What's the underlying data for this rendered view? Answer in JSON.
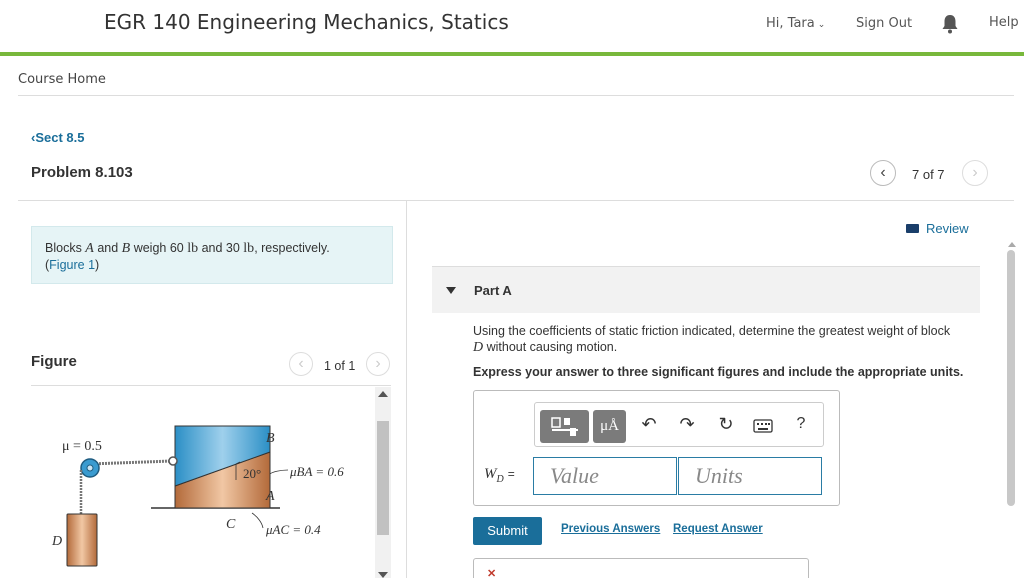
{
  "header": {
    "course_title": "EGR 140 Engineering Mechanics, Statics",
    "greeting": "Hi, Tara",
    "sign_out": "Sign Out",
    "help": "Help"
  },
  "breadcrumb": "Course Home",
  "back_link": "Sect 8.5",
  "problem_title": "Problem 8.103",
  "pager": {
    "label": "7 of 7"
  },
  "statement": {
    "t1": "Blocks ",
    "a": "A",
    "t2": " and ",
    "b": "B",
    "t3": " weigh 60 ",
    "u1": "lb",
    "t4": " and 30 ",
    "u2": "lb",
    "t5": ", respectively.",
    "fig_open": "(",
    "fig_link": "Figure 1",
    "fig_close": ")"
  },
  "figure": {
    "label": "Figure",
    "count": "1 of 1",
    "mu_pulley": "μ = 0.5",
    "label_b": "B",
    "label_a": "A",
    "label_c": "C",
    "label_d": "D",
    "angle": "20°",
    "mu_ba": "μBA = 0.6",
    "mu_ac": "μAC = 0.4"
  },
  "review": "Review",
  "part": {
    "title": "Part A",
    "question_1": "Using the coefficients of static friction indicated, determine the greatest weight of block",
    "question_d": "D",
    "question_2": " without causing motion.",
    "instruction": "Express your answer to three significant figures and include the appropriate units."
  },
  "answer": {
    "var_w": "W",
    "var_sub": "D",
    "eq": "=",
    "value_placeholder": "Value",
    "units_placeholder": "Units",
    "toolbar": {
      "help_glyph": "?",
      "mu_glyph": "μÅ"
    }
  },
  "buttons": {
    "submit": "Submit",
    "previous_answers": "Previous Answers",
    "request_answer": "Request Answer"
  },
  "colors": {
    "accent_green": "#78b83b",
    "link_blue": "#1a6e9a"
  }
}
